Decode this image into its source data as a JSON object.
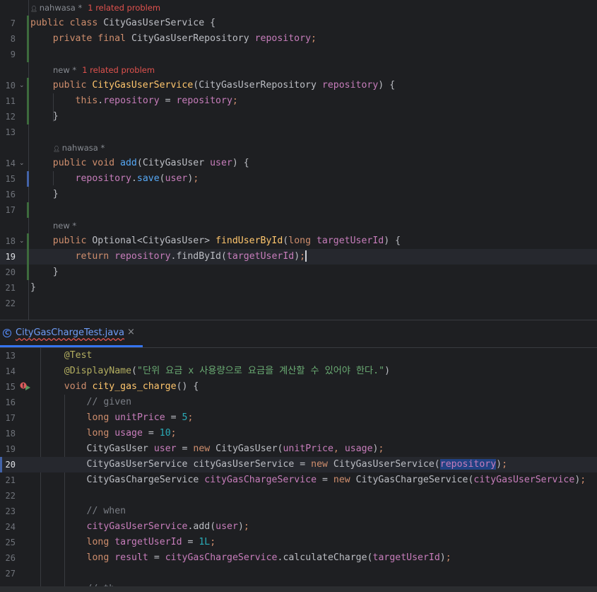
{
  "top_editor": {
    "lines": [
      {
        "hint": {
          "author": "nahwasa *",
          "problem": "1 related problem"
        }
      },
      {
        "num": "7",
        "mark": "g",
        "tokens": [
          [
            "kw",
            "public "
          ],
          [
            "kw",
            "class "
          ],
          [
            "",
            "CityGasUserService "
          ],
          [
            "",
            "{"
          ]
        ]
      },
      {
        "num": "8",
        "mark": "g",
        "tokens": [
          [
            "",
            "    "
          ],
          [
            "kw",
            "private "
          ],
          [
            "kw",
            "final "
          ],
          [
            "",
            "CityGasUserRepository "
          ],
          [
            "fd",
            "repository"
          ],
          [
            "kw",
            ";"
          ]
        ]
      },
      {
        "num": "9",
        "mark": "g",
        "tokens": []
      },
      {
        "hint": {
          "author": "new *",
          "problem": "1 related problem"
        },
        "indent": "    "
      },
      {
        "num": "10",
        "mark": "g",
        "fold": "⌄",
        "tokens": [
          [
            "",
            "    "
          ],
          [
            "kw",
            "public "
          ],
          [
            "dc",
            "CityGasUserService"
          ],
          [
            "",
            "(CityGasUserRepository "
          ],
          [
            "lv",
            "repository"
          ],
          [
            "",
            ") "
          ],
          [
            "",
            "{"
          ]
        ]
      },
      {
        "num": "11",
        "mark": "g",
        "tokens": [
          [
            "",
            "        "
          ],
          [
            "kw",
            "this"
          ],
          [
            "",
            "."
          ],
          [
            "fd",
            "repository"
          ],
          [
            "",
            " = "
          ],
          [
            "lv",
            "repository"
          ],
          [
            "kw",
            ";"
          ]
        ]
      },
      {
        "num": "12",
        "mark": "g",
        "tokens": [
          [
            "",
            "    "
          ],
          [
            "",
            "}"
          ]
        ]
      },
      {
        "num": "13",
        "tokens": []
      },
      {
        "hint": {
          "author": "nahwasa *"
        },
        "indent": "    "
      },
      {
        "num": "14",
        "fold": "⌄",
        "tokens": [
          [
            "",
            "    "
          ],
          [
            "kw",
            "public "
          ],
          [
            "kw",
            "void "
          ],
          [
            "fn",
            "add"
          ],
          [
            "",
            "(CityGasUser "
          ],
          [
            "lv",
            "user"
          ],
          [
            "",
            ") "
          ],
          [
            "",
            "{"
          ]
        ]
      },
      {
        "num": "15",
        "mark": "b",
        "tokens": [
          [
            "",
            "        "
          ],
          [
            "fd",
            "repository"
          ],
          [
            "",
            "."
          ],
          [
            "fn",
            "save"
          ],
          [
            "",
            "("
          ],
          [
            "lv",
            "user"
          ],
          [
            "",
            ")"
          ],
          [
            "kw",
            ";"
          ]
        ]
      },
      {
        "num": "16",
        "tokens": [
          [
            "",
            "    "
          ],
          [
            "",
            "}"
          ]
        ]
      },
      {
        "num": "17",
        "mark": "g",
        "tokens": []
      },
      {
        "hint": {
          "author": "new *"
        },
        "indent": "    "
      },
      {
        "num": "18",
        "mark": "g",
        "fold": "⌄",
        "tokens": [
          [
            "",
            "    "
          ],
          [
            "kw",
            "public "
          ],
          [
            "",
            "Optional<CityGasUser> "
          ],
          [
            "dc",
            "findUserById"
          ],
          [
            "",
            "("
          ],
          [
            "kw",
            "long "
          ],
          [
            "lv",
            "targetUserId"
          ],
          [
            "",
            ") "
          ],
          [
            "",
            "{"
          ]
        ]
      },
      {
        "num": "19",
        "mark": "g",
        "current": true,
        "caret": true,
        "tokens": [
          [
            "",
            "        "
          ],
          [
            "kw",
            "return "
          ],
          [
            "fd",
            "repository"
          ],
          [
            "",
            "."
          ],
          [
            "",
            "findById("
          ],
          [
            "lv",
            "targetUserId"
          ],
          [
            "",
            ")"
          ],
          [
            "kw",
            ";"
          ]
        ]
      },
      {
        "num": "20",
        "mark": "g",
        "tokens": [
          [
            "",
            "    "
          ],
          [
            "",
            "}"
          ]
        ]
      },
      {
        "num": "21",
        "tokens": [
          [
            "",
            "}"
          ]
        ]
      },
      {
        "num": "22",
        "tokens": []
      }
    ]
  },
  "tab": {
    "label": "CityGasChargeTest.java",
    "close": "×",
    "icon_glyph": "C"
  },
  "bottom_editor": {
    "lines": [
      {
        "num": "13",
        "tokens": [
          [
            "",
            "    "
          ],
          [
            "ann",
            "@Test"
          ]
        ]
      },
      {
        "num": "14",
        "tokens": [
          [
            "",
            "    "
          ],
          [
            "ann",
            "@DisplayName"
          ],
          [
            "",
            "("
          ],
          [
            "st",
            "\"단위 요금 x 사용량으로 요금을 계산할 수 있어야 한다.\""
          ],
          [
            "",
            ")"
          ]
        ]
      },
      {
        "num": "15",
        "run": true,
        "tokens": [
          [
            "",
            "    "
          ],
          [
            "kw",
            "void "
          ],
          [
            "dc",
            "city_gas_charge"
          ],
          [
            "",
            "() "
          ],
          [
            "",
            "{"
          ]
        ]
      },
      {
        "num": "16",
        "tokens": [
          [
            "",
            "        "
          ],
          [
            "cm",
            "// given"
          ]
        ]
      },
      {
        "num": "17",
        "tokens": [
          [
            "",
            "        "
          ],
          [
            "kw",
            "long "
          ],
          [
            "lv",
            "unitPrice"
          ],
          [
            "",
            " = "
          ],
          [
            "nm",
            "5"
          ],
          [
            "kw",
            ";"
          ]
        ]
      },
      {
        "num": "18",
        "tokens": [
          [
            "",
            "        "
          ],
          [
            "kw",
            "long "
          ],
          [
            "lv",
            "usage"
          ],
          [
            "",
            " = "
          ],
          [
            "nm",
            "10"
          ],
          [
            "kw",
            ";"
          ]
        ]
      },
      {
        "num": "19",
        "tokens": [
          [
            "",
            "        "
          ],
          [
            "",
            "CityGasUser "
          ],
          [
            "lv",
            "user"
          ],
          [
            "",
            " = "
          ],
          [
            "kw",
            "new "
          ],
          [
            "",
            "CityGasUser("
          ],
          [
            "lv",
            "unitPrice"
          ],
          [
            "kw",
            ", "
          ],
          [
            "lv",
            "usage"
          ],
          [
            "",
            ")"
          ],
          [
            "kw",
            ";"
          ]
        ]
      },
      {
        "num": "20",
        "mark": "b",
        "current": true,
        "tokens": [
          [
            "",
            "        "
          ],
          [
            "",
            "CityGasUserService cityGasUserService = "
          ],
          [
            "kw",
            "new "
          ],
          [
            "",
            "CityGasUserService("
          ],
          [
            "sel fd",
            "repository"
          ],
          [
            "",
            ")"
          ],
          [
            "kw",
            ";"
          ]
        ]
      },
      {
        "num": "21",
        "tokens": [
          [
            "",
            "        "
          ],
          [
            "",
            "CityGasChargeService "
          ],
          [
            "lv",
            "cityGasChargeService"
          ],
          [
            "",
            " = "
          ],
          [
            "kw",
            "new "
          ],
          [
            "",
            "CityGasChargeService("
          ],
          [
            "lv",
            "cityGasUserService"
          ],
          [
            "",
            ")"
          ],
          [
            "kw",
            ";"
          ]
        ]
      },
      {
        "num": "22",
        "tokens": []
      },
      {
        "num": "23",
        "tokens": [
          [
            "",
            "        "
          ],
          [
            "cm",
            "// when"
          ]
        ]
      },
      {
        "num": "24",
        "tokens": [
          [
            "",
            "        "
          ],
          [
            "lv",
            "cityGasUserService"
          ],
          [
            "",
            "."
          ],
          [
            "",
            "add("
          ],
          [
            "lv",
            "user"
          ],
          [
            "",
            ")"
          ],
          [
            "kw",
            ";"
          ]
        ]
      },
      {
        "num": "25",
        "tokens": [
          [
            "",
            "        "
          ],
          [
            "kw",
            "long "
          ],
          [
            "lv",
            "targetUserId"
          ],
          [
            "",
            " = "
          ],
          [
            "nm",
            "1L"
          ],
          [
            "kw",
            ";"
          ]
        ]
      },
      {
        "num": "26",
        "tokens": [
          [
            "",
            "        "
          ],
          [
            "kw",
            "long "
          ],
          [
            "lv",
            "result"
          ],
          [
            "",
            " = "
          ],
          [
            "lv",
            "cityGasChargeService"
          ],
          [
            "",
            "."
          ],
          [
            "",
            "calculateCharge("
          ],
          [
            "lv",
            "targetUserId"
          ],
          [
            "",
            ")"
          ],
          [
            "kw",
            ";"
          ]
        ]
      },
      {
        "num": "27",
        "tokens": []
      },
      {
        "num": "",
        "tokens": [
          [
            "",
            "        "
          ],
          [
            "cm",
            "// th"
          ]
        ]
      }
    ]
  }
}
